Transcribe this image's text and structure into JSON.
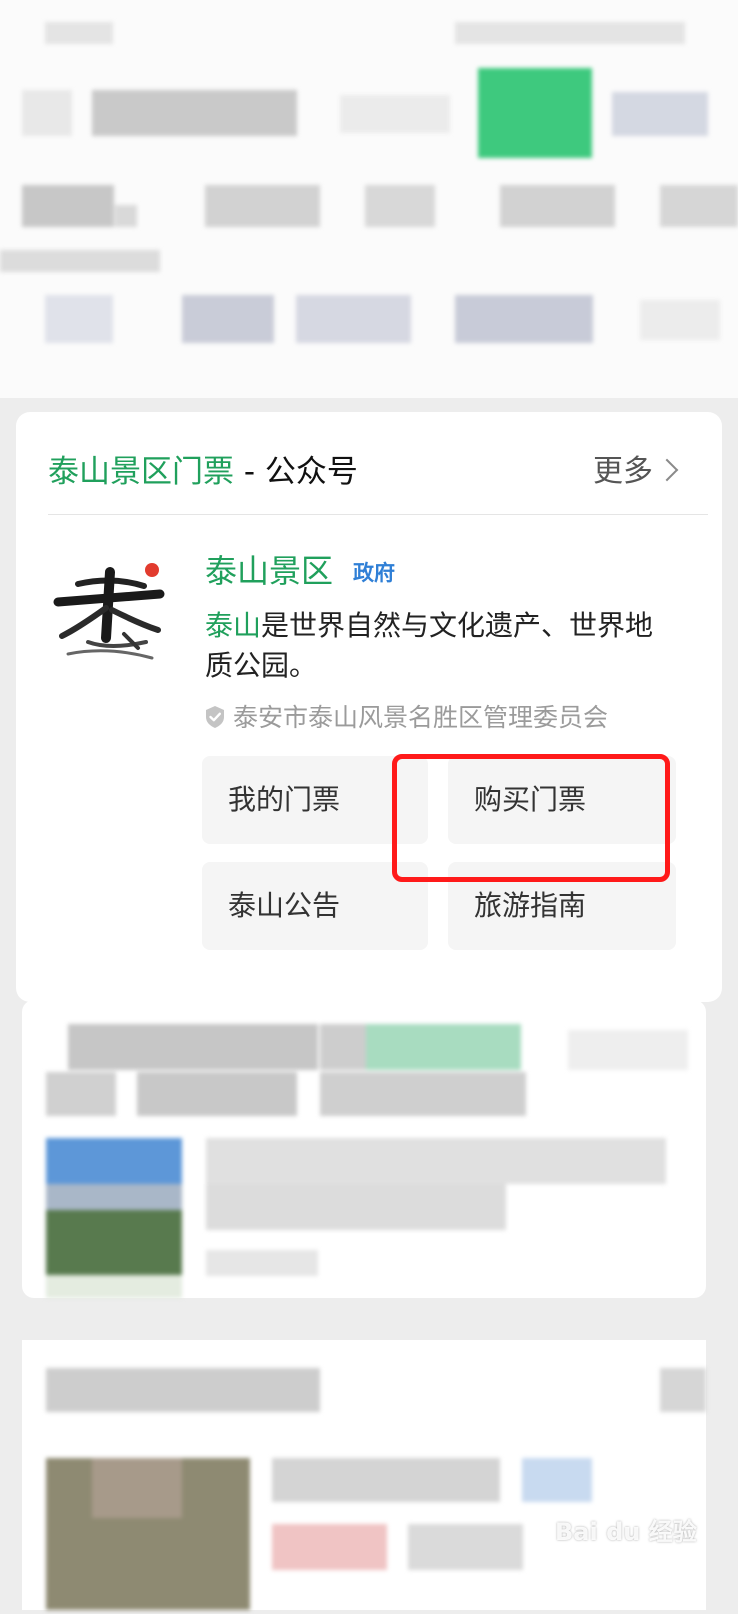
{
  "official_account_card": {
    "header": {
      "title_keyword": "泰山景区门票",
      "title_separator": " - ",
      "title_suffix": "公众号",
      "more_label": "更多"
    },
    "account": {
      "name": "泰山景区",
      "badge": "政府",
      "logo_character": "泰",
      "description_highlight": "泰山",
      "description_rest": "是世界自然与文化遗产、世界地质公园。",
      "verified_by": "泰安市泰山风景名胜区管理委员会"
    },
    "buttons": [
      {
        "label": "我的门票"
      },
      {
        "label": "购买门票"
      },
      {
        "label": "泰山公告"
      },
      {
        "label": "旅游指南"
      }
    ],
    "annotation": {
      "highlight_color": "#ff1a1a",
      "highlighted_button": "购买门票"
    }
  },
  "colors": {
    "accent_green": "#20a05c",
    "badge_blue": "#2f7fd6",
    "page_background": "#ededed",
    "card_background": "#ffffff"
  },
  "watermark": {
    "text": "Bai du 经验"
  }
}
